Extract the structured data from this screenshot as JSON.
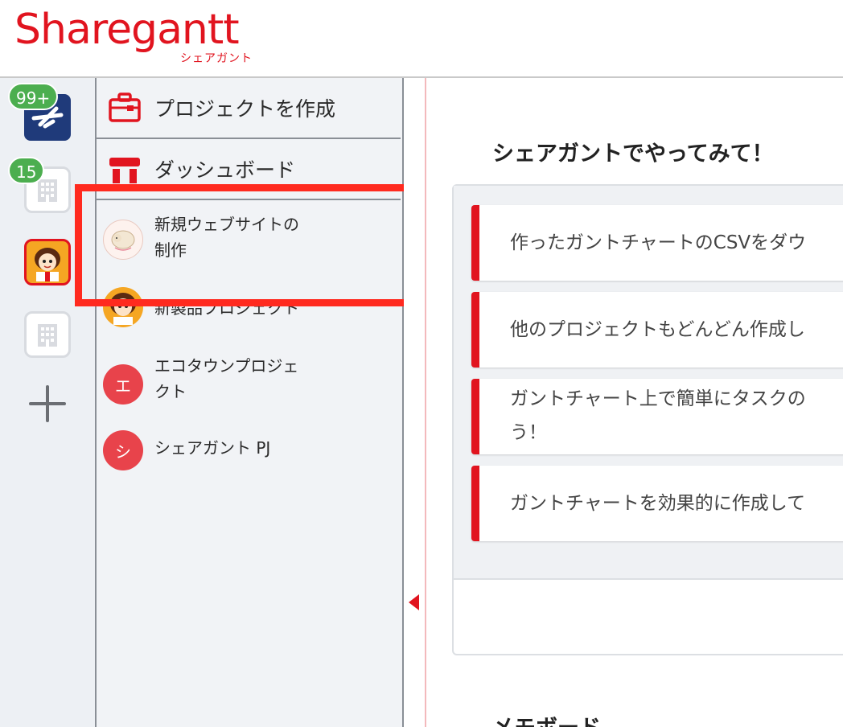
{
  "app": {
    "logo_text": "Sharegantt",
    "logo_subtext": "シェアガント",
    "brand_color": "#e1141f"
  },
  "rail": {
    "workspaces": [
      {
        "icon": "airline-icon",
        "badge": "99+"
      },
      {
        "icon": "building-icon",
        "badge": "15"
      },
      {
        "icon": "girl-avatar-icon",
        "active": true
      },
      {
        "icon": "building-icon"
      }
    ],
    "add_icon": "plus-icon"
  },
  "menu": {
    "create_project": "プロジェクトを作成",
    "dashboard": "ダッシュボード"
  },
  "projects": [
    {
      "name": "新規ウェブサイトの制作",
      "line1": "新規ウェブサイトの",
      "line2": "制作",
      "avatar": "sheep-avatar"
    },
    {
      "name": "新製品プロジェクト",
      "line1": "新製品プロジェクト",
      "line2": "",
      "avatar": "girl-avatar"
    },
    {
      "name": "エコタウンプロジェクト",
      "line1": "エコタウンプロジェ",
      "line2": "クト",
      "avatar_letter": "エ"
    },
    {
      "name": "シェアガント PJ",
      "line1": "シェアガント PJ",
      "line2": "",
      "avatar_letter": "シ"
    }
  ],
  "main": {
    "title": "シェアガントでやってみて！",
    "tips": [
      {
        "text": "作ったガントチャートのCSVをダウ"
      },
      {
        "text": "他のプロジェクトもどんどん作成し"
      },
      {
        "line1": "ガントチャート上で簡単にタスクの",
        "line2": "う！"
      },
      {
        "text": "ガントチャートを効果的に作成して"
      }
    ],
    "memo_title": "メモボード"
  }
}
